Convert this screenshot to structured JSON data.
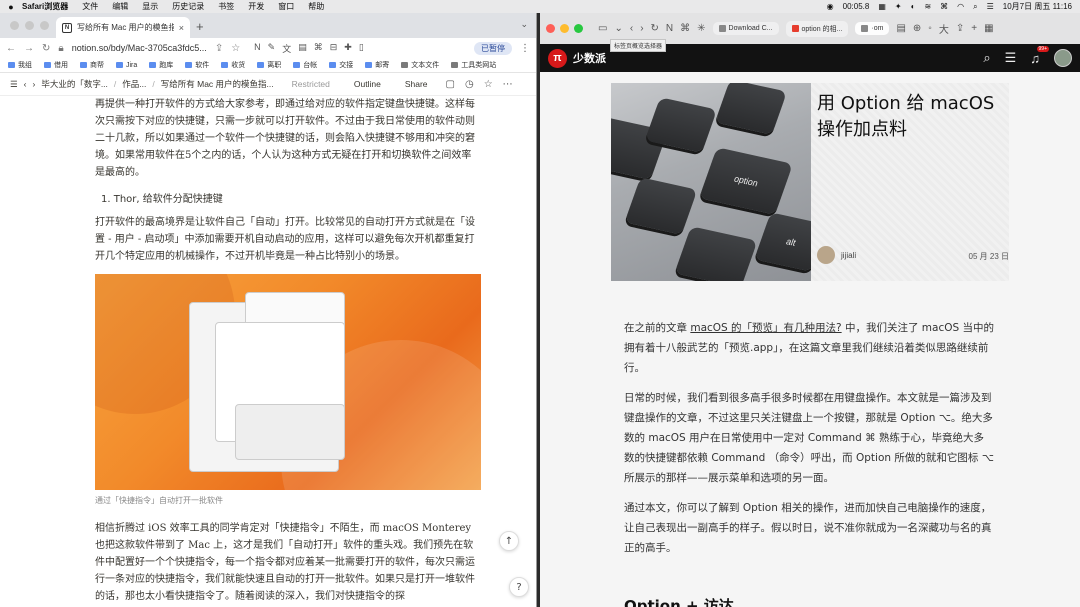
{
  "menubar": {
    "apple": "",
    "app": "Safari浏览器",
    "items": [
      "文件",
      "编辑",
      "显示",
      "历史记录",
      "书签",
      "开发",
      "窗口",
      "帮助"
    ],
    "timer": "00:05.8",
    "datetime": "10月7日 周五  11:16"
  },
  "left": {
    "tab": {
      "icon": "N",
      "title": "写给所有 Mac 用户的模鱼指南",
      "close": "×"
    },
    "newtab": "+",
    "tabdown": "⌄",
    "address": {
      "url": "notion.so/bdy/Mac-3705ca3fdc5...",
      "pause": "已暂停"
    },
    "bookmarks": [
      "我组",
      "借用",
      "商帮",
      "Jira",
      "跑库",
      "软件",
      "收货",
      "离职",
      "台帐",
      "交接",
      "邮寄",
      "文本文件",
      "工具类网站"
    ],
    "notion": {
      "crumbs": [
        "毕大业的「数字...",
        "作品...",
        "写给所有 Mac 用户的模鱼指..."
      ],
      "restricted": "Restricted",
      "outline": "Outline",
      "share": "Share"
    },
    "para1": "再提供一种打开软件的方式给大家参考，即通过给对应的软件指定键盘快捷键。这样每次只需按下对应的快捷键，只需一步就可以打开软件。不过由于我日常使用的软件动则二十几款，所以如果通过一个软件一个快捷键的话，则会陷入快捷键不够用和冲突的窘境。如果常用软件在5个之内的话，个人认为这种方式无疑在打开和切换软件之间效率是最高的。",
    "olitem": "1.  Thor, 给软件分配快捷键",
    "para2": "打开软件的最高境界是让软件自己「自动」打开。比较常见的自动打开方式就是在「设置 - 用户 - 启动项」中添加需要开机自动启动的应用，这样可以避免每次开机都重复打开几个特定应用的机械操作，不过开机毕竟是一种占比特别小的场景。",
    "caption": "通过「快捷指令」自动打开一批软件",
    "para3": "相信折腾过 iOS 效率工具的同学肯定对「快捷指令」不陌生，而 macOS Monterey 也把这款软件带到了 Mac 上，这才是我们「自动打开」软件的重头戏。我们预先在软件中配置好一个个快捷指令，每一个指令都对应着某一批需要打开的软件，每次只需运行一条对应的快捷指令，我们就能快速且自动的打开一批软件。如果只是打开一堆软件的话，那也太小看快捷指令了。随着阅读的深入，我们对快捷指令的探",
    "scrollup": "↑",
    "help": "?"
  },
  "right": {
    "tabs": [
      "Download C...",
      "option 的相...",
      "·om"
    ],
    "tooltip": "标签页概览选择器",
    "brand": "少数派",
    "bell_badge": "99+",
    "article": {
      "title": "用 Option 给 macOS 操作加点料",
      "author": "jijiali",
      "date": "05 月 23 日",
      "key_label": "option",
      "key_label2": "alt"
    },
    "p1_pre": "在之前的文章 ",
    "p1_link": "macOS 的「预览」有几种用法?",
    "p1_post": " 中，我们关注了 macOS 当中的拥有着十八般武艺的「预览.app」，在这篇文章里我们继续沿着类似思路继续前行。",
    "p2": "日常的时候，我们看到很多高手很多时候都在用键盘操作。本文就是一篇涉及到键盘操作的文章，不过这里只关注键盘上一个按键，那就是 Option ⌥。绝大多数的 macOS 用户在日常使用中一定对 Command ⌘ 熟练于心，毕竟绝大多数的快捷键都依赖 Command （命令）呼出，而 Option 所做的就和它图标 ⌥ 所展示的那样——展示菜单和选项的另一面。",
    "p3": "通过本文，你可以了解到 Option 相关的操作，进而加快自己电脑操作的速度，让自己表现出一副高手的样子。假以时日，说不准你就成为一名深藏功与名的真正的高手。",
    "heading": "Option + 访达"
  }
}
